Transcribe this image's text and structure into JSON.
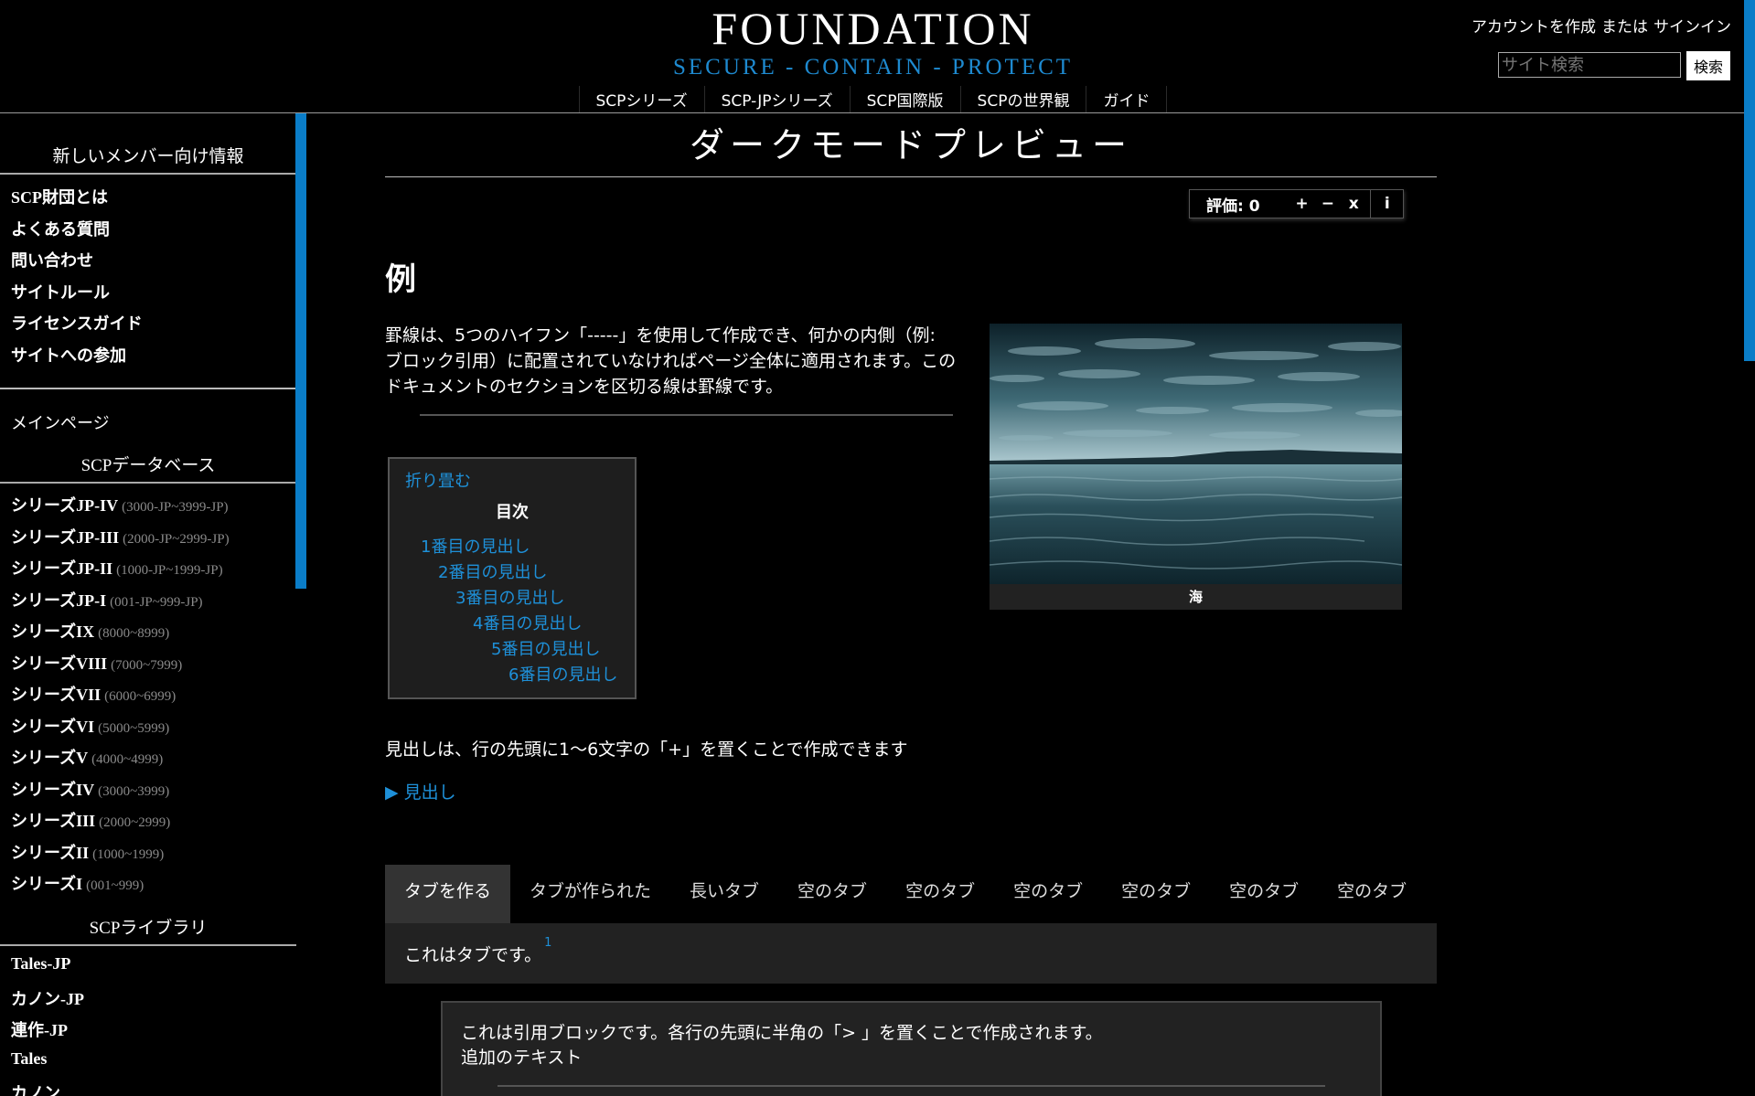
{
  "header": {
    "site_title": "FOUNDATION",
    "site_subtitle": "SECURE - CONTAIN - PROTECT",
    "nav": [
      "SCPシリーズ",
      "SCP-JPシリーズ",
      "SCP国際版",
      "SCPの世界観",
      "ガイド"
    ],
    "account_create": "アカウントを作成",
    "account_or": "または",
    "account_signin": "サインイン",
    "search_placeholder": "サイト検索",
    "search_button": "検索"
  },
  "sidebar": {
    "new_members_heading": "新しいメンバー向け情報",
    "new_members_items": [
      "SCP財団とは",
      "よくある質問",
      "問い合わせ",
      "サイトルール",
      "ライセンスガイド",
      "サイトへの参加"
    ],
    "main_page": "メインページ",
    "database_heading": "SCPデータベース",
    "series": [
      {
        "name": "シリーズJP-IV",
        "range": "(3000-JP~3999-JP)"
      },
      {
        "name": "シリーズJP-III",
        "range": "(2000-JP~2999-JP)"
      },
      {
        "name": "シリーズJP-II",
        "range": "(1000-JP~1999-JP)"
      },
      {
        "name": "シリーズJP-I",
        "range": "(001-JP~999-JP)"
      },
      {
        "name": "シリーズIX",
        "range": "(8000~8999)"
      },
      {
        "name": "シリーズVIII",
        "range": "(7000~7999)"
      },
      {
        "name": "シリーズVII",
        "range": "(6000~6999)"
      },
      {
        "name": "シリーズVI",
        "range": "(5000~5999)"
      },
      {
        "name": "シリーズV",
        "range": "(4000~4999)"
      },
      {
        "name": "シリーズIV",
        "range": "(3000~3999)"
      },
      {
        "name": "シリーズIII",
        "range": "(2000~2999)"
      },
      {
        "name": "シリーズII",
        "range": "(1000~1999)"
      },
      {
        "name": "シリーズI",
        "range": "(001~999)"
      }
    ],
    "library_heading": "SCPライブラリ",
    "library_items": [
      "Tales-JP",
      "カノン-JP",
      "連作-JP",
      "Tales",
      "カノン"
    ]
  },
  "main": {
    "page_title": "ダークモードプレビュー",
    "rating_label": "評価: 0",
    "rating_plus": "+",
    "rating_minus": "−",
    "rating_cancel": "x",
    "rating_info": "i",
    "section_heading": "例",
    "paragraph1": "罫線は、5つのハイフン「-----」を使用して作成でき、何かの内側（例: ブロック引用）に配置されていなければページ全体に適用されます。このドキュメントのセクションを区切る線は罫線です。",
    "figure_caption": "海",
    "toc": {
      "collapse": "折り畳む",
      "title": "目次",
      "entries": [
        "1番目の見出し",
        "2番目の見出し",
        "3番目の見出し",
        "4番目の見出し",
        "5番目の見出し",
        "6番目の見出し"
      ]
    },
    "paragraph2": "見出しは、行の先頭に1～6文字の「+」を置くことで作成できます",
    "collapsible": "▶ 見出し",
    "tabs": [
      "タブを作る",
      "タブが作られた",
      "長いタブ",
      "空のタブ",
      "空のタブ",
      "空のタブ",
      "空のタブ",
      "空のタブ",
      "空のタブ"
    ],
    "tab_content": "これはタブです。",
    "tab_footnote": "1",
    "blockquote_line1": "これは引用ブロックです。各行の先頭に半角の「> 」を置くことで作成されます。",
    "blockquote_line2": "追加のテキスト"
  },
  "colors": {
    "accent": "#0a7dc8",
    "link": "#1e90d8",
    "background": "#000000",
    "panel": "#222222"
  }
}
